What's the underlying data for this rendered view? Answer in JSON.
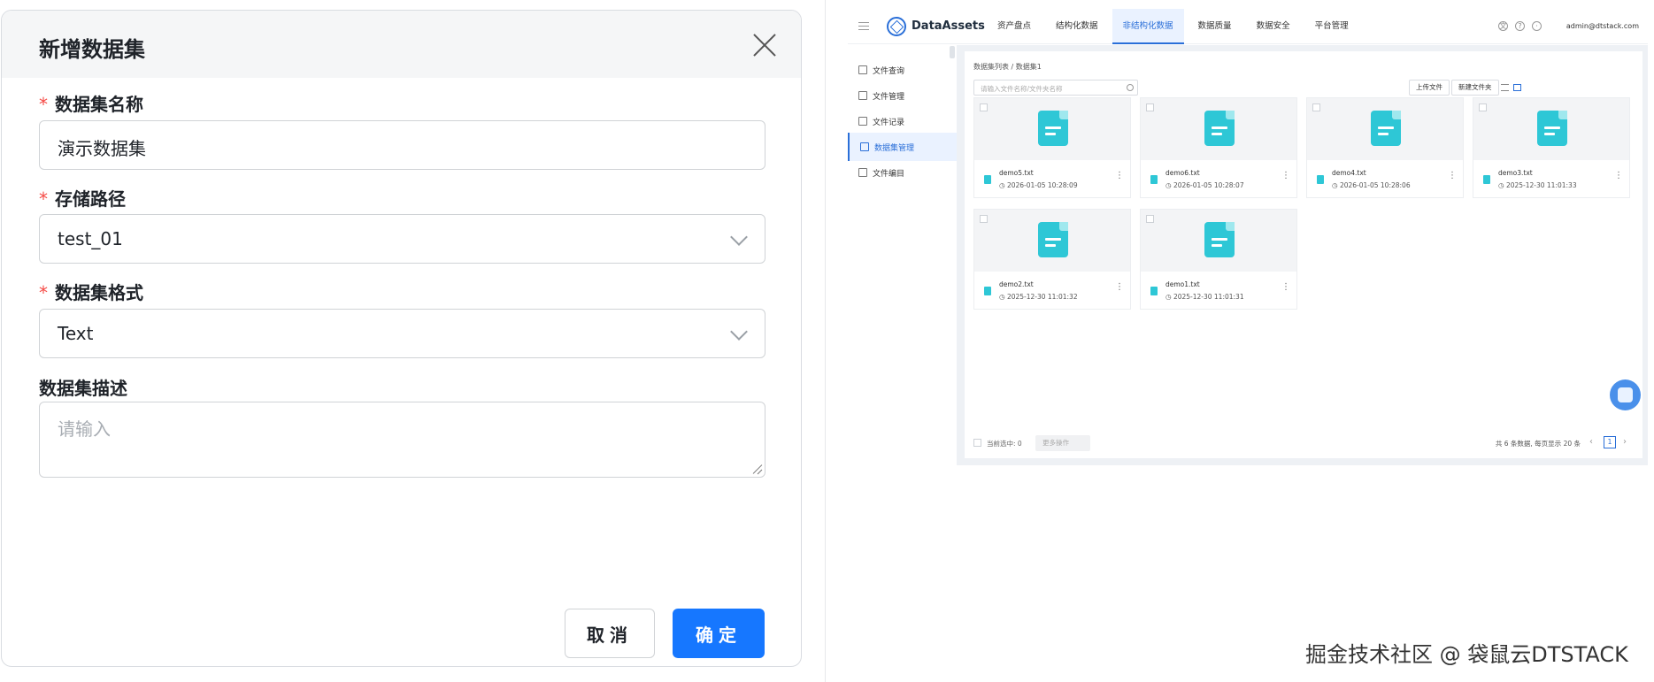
{
  "modal": {
    "title": "新增数据集",
    "fields": [
      {
        "label": "数据集名称",
        "required": true,
        "value": "演示数据集"
      },
      {
        "label": "存储路径",
        "required": true,
        "value": "test_01"
      },
      {
        "label": "数据集格式",
        "required": true,
        "value": "Text"
      },
      {
        "label": "数据集描述",
        "required": false,
        "placeholder": "请输入"
      }
    ],
    "required_mark": "*",
    "cancel_label": "取消",
    "ok_label": "确定"
  },
  "app": {
    "brand": "DataAssets",
    "nav": [
      "资产盘点",
      "结构化数据",
      "非结构化数据",
      "数据质量",
      "数据安全",
      "平台管理"
    ],
    "nav_active": "非结构化数据",
    "top_icons": [
      "language-icon",
      "help-icon",
      "user-icon"
    ],
    "user": "admin@dtstack.com",
    "sidebar": [
      "文件查询",
      "文件管理",
      "文件记录",
      "数据集管理",
      "文件编目"
    ],
    "sidebar_active": "数据集管理",
    "breadcrumb": "数据集列表 / 数据集1",
    "search_placeholder": "请输入文件名称/文件夹名称",
    "upload_label": "上传文件",
    "new_folder_label": "新建文件夹",
    "files": [
      {
        "name": "demo5.txt",
        "date": "2026-01-05 10:28:09"
      },
      {
        "name": "demo6.txt",
        "date": "2026-01-05 10:28:07"
      },
      {
        "name": "demo4.txt",
        "date": "2026-01-05 10:28:06"
      },
      {
        "name": "demo3.txt",
        "date": "2025-12-30 11:01:33"
      },
      {
        "name": "demo2.txt",
        "date": "2025-12-30 11:01:32"
      },
      {
        "name": "demo1.txt",
        "date": "2025-12-30 11:01:31"
      }
    ],
    "footer": {
      "selected_text": "当前选中: 0",
      "batch_label": "更多操作",
      "total_text": "共 6 条数据, 每页显示 20 条",
      "page": "1",
      "prev": "‹",
      "next": "›"
    },
    "colors": {
      "accent": "#2a6fd8",
      "file_icon": "#2ec7d6"
    }
  },
  "watermark": "掘金技术社区 @ 袋鼠云DTSTACK",
  "colors": {
    "primary": "#1677ff",
    "required": "#f54a45"
  }
}
